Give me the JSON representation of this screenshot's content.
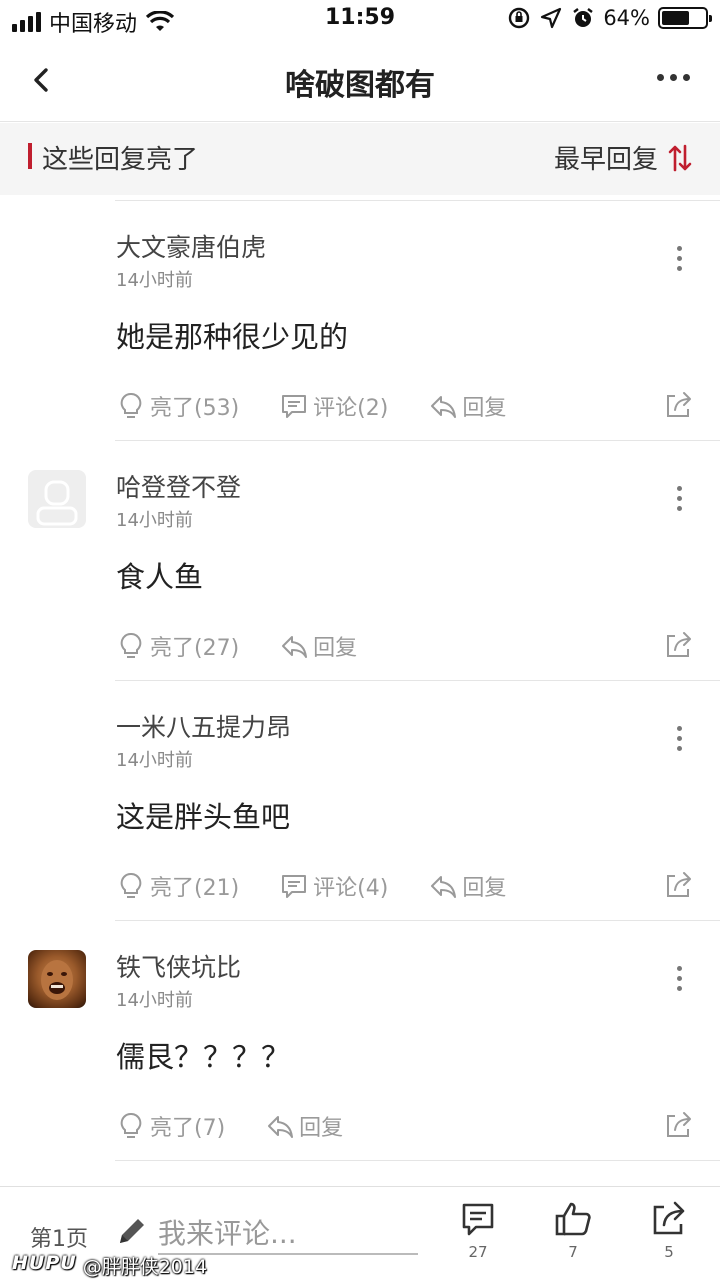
{
  "status_bar": {
    "carrier": "中国移动",
    "time": "11:59",
    "battery_percent": "64%",
    "battery_level": 0.64
  },
  "navbar": {
    "title": "啥破图都有"
  },
  "section_header": {
    "title": "这些回复亮了",
    "sort_label": "最早回复"
  },
  "comments": [
    {
      "username": "大文豪唐伯虎",
      "time": "14小时前",
      "text": "她是那种很少见的",
      "like_label": "亮了(53)",
      "comment_label": "评论(2)",
      "reply_label": "回复"
    },
    {
      "username": "哈登登不登",
      "time": "14小时前",
      "text": "食人鱼",
      "like_label": "亮了(27)",
      "reply_label": "回复"
    },
    {
      "username": "一米八五提力昂",
      "time": "14小时前",
      "text": "这是胖头鱼吧",
      "like_label": "亮了(21)",
      "comment_label": "评论(4)",
      "reply_label": "回复"
    },
    {
      "username": "铁飞侠坑比",
      "time": "14小时前",
      "text": "儒艮？？？？",
      "like_label": "亮了(7)",
      "reply_label": "回复"
    }
  ],
  "bottom_bar": {
    "page": "第1页",
    "input_placeholder": "我来评论...",
    "comment_count": "27",
    "like_count": "7",
    "share_count": "5"
  },
  "watermark": {
    "logo": "HUPU",
    "handle": "@胖胖侠2014"
  },
  "colors": {
    "accent": "#c01e2e",
    "muted": "#9a9a9a"
  }
}
